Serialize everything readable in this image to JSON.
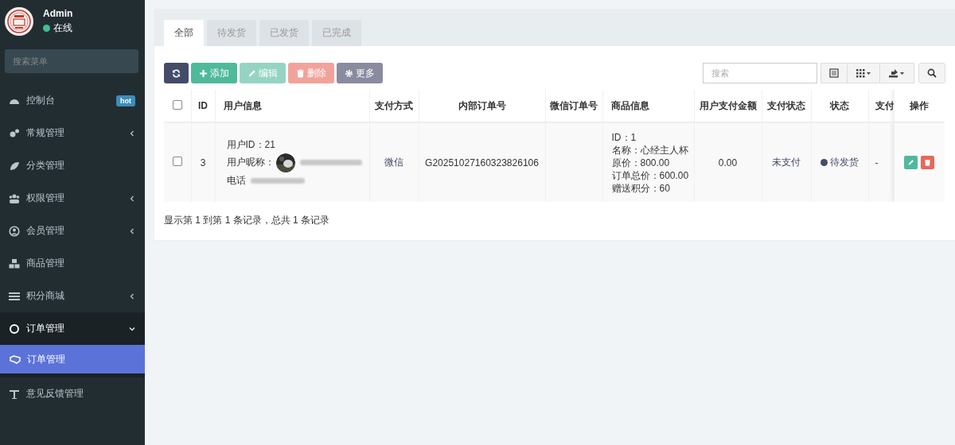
{
  "sidebar": {
    "user": {
      "name": "Admin",
      "status": "在线",
      "online": true
    },
    "search": {
      "placeholder": "搜索菜单"
    },
    "items": [
      {
        "kind": "link",
        "label": "控制台",
        "badge": "hot",
        "selected": false
      },
      {
        "kind": "group",
        "label": "常规管理",
        "expanded": false,
        "selected": false
      },
      {
        "kind": "link",
        "label": "分类管理",
        "selected": false
      },
      {
        "kind": "group",
        "label": "权限管理",
        "expanded": false,
        "selected": false
      },
      {
        "kind": "group",
        "label": "会员管理",
        "expanded": false,
        "selected": false
      },
      {
        "kind": "link",
        "label": "商品管理",
        "selected": false
      },
      {
        "kind": "group",
        "label": "积分商城",
        "expanded": false,
        "selected": false
      },
      {
        "kind": "group",
        "label": "订单管理",
        "expanded": true,
        "selected": false,
        "children": [
          {
            "label": "订单管理",
            "selected": true
          }
        ]
      },
      {
        "kind": "link",
        "label": "意见反馈管理",
        "selected": false
      }
    ]
  },
  "tabs": [
    {
      "label": "全部",
      "selected": true
    },
    {
      "label": "待发货",
      "selected": false
    },
    {
      "label": "已发货",
      "selected": false
    },
    {
      "label": "已完成",
      "selected": false
    }
  ],
  "toolbar": {
    "buttons": [
      {
        "kind": "refresh",
        "disabled": false
      },
      {
        "kind": "add",
        "label": "添加",
        "disabled": false
      },
      {
        "kind": "edit",
        "label": "编辑",
        "disabled": true
      },
      {
        "kind": "delete",
        "label": "删除",
        "disabled": true
      },
      {
        "kind": "more",
        "label": "更多",
        "disabled": false
      }
    ],
    "search": {
      "placeholder": "搜索"
    }
  },
  "table": {
    "select_all_checked": false,
    "columns": [
      "ID",
      "用户信息",
      "支付方式",
      "内部订单号",
      "微信订单号",
      "商品信息",
      "用户支付金额",
      "支付状态",
      "状态",
      "支付",
      "操作"
    ],
    "rows": [
      {
        "checked": false,
        "id": "3",
        "user_id": "用户ID：21",
        "nickname_label": "用户昵称：",
        "phone_label": "电话",
        "payment": "微信",
        "order_no": "G20251027160323826106",
        "goods": [
          "ID：1",
          "名称：心经主人杯",
          "原价：800.00",
          "订单总价：600.00",
          "赠送积分：60"
        ],
        "amount": "0.00",
        "pay_status": "未支付",
        "status": {
          "label": "待发货",
          "color": "#444c69"
        },
        "column_10": "-"
      }
    ]
  },
  "footer": "显示第 1 到第 1 条记录，总共 1 条记录"
}
